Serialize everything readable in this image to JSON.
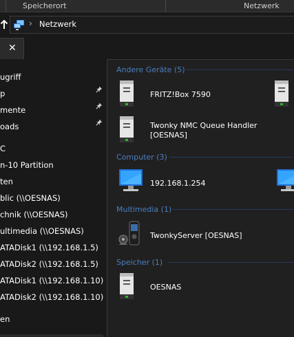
{
  "ribbon": {
    "group_location": "Speicherort",
    "group_network": "Netzwerk"
  },
  "address": {
    "path": "Netzwerk"
  },
  "tab": {
    "close_glyph": "✕"
  },
  "sidebar": {
    "items": [
      {
        "label": "ugriff",
        "pinned": false
      },
      {
        "label": "p",
        "pinned": true
      },
      {
        "label": "mente",
        "pinned": true
      },
      {
        "label": "oads",
        "pinned": true
      },
      {
        "label": "C",
        "pinned": false
      },
      {
        "label": "n-10 Partition",
        "pinned": false
      },
      {
        "label": "ten",
        "pinned": false
      },
      {
        "label": "blic (\\\\OESNAS)",
        "pinned": false
      },
      {
        "label": "chnik (\\\\OESNAS)",
        "pinned": false
      },
      {
        "label": "ultimedia (\\\\OESNAS)",
        "pinned": false
      },
      {
        "label": "ATADisk1 (\\\\192.168.1.5)",
        "pinned": false
      },
      {
        "label": "ATADisk2 (\\\\192.168.1.5)",
        "pinned": false
      },
      {
        "label": "ATADisk1 (\\\\192.168.1.10)",
        "pinned": false
      },
      {
        "label": "ATADisk2 (\\\\192.168.1.10)",
        "pinned": false
      },
      {
        "label": "en",
        "pinned": false
      }
    ]
  },
  "content": {
    "groups": [
      {
        "header": "Andere Geräte (5)",
        "items": [
          {
            "label": "FRITZ!Box 7590",
            "icon": "server-icon"
          },
          {
            "label": "Twonky NMC Queue Handler [OESNAS]",
            "icon": "server-icon"
          }
        ]
      },
      {
        "header": "Computer (3)",
        "items": [
          {
            "label": "192.168.1.254",
            "icon": "computer-icon"
          }
        ]
      },
      {
        "header": "Multimedia (1)",
        "items": [
          {
            "label": "TwonkyServer [OESNAS]",
            "icon": "media-device-icon"
          }
        ]
      },
      {
        "header": "Speicher (1)",
        "items": [
          {
            "label": "OESNAS",
            "icon": "server-icon"
          }
        ]
      }
    ],
    "twonky_line1": "Twonky NMC Queue Handler",
    "twonky_line2": "[OESNAS]"
  },
  "colors": {
    "group_header": "#4a7fc0",
    "background": "#191919",
    "content_bg": "#202020"
  }
}
